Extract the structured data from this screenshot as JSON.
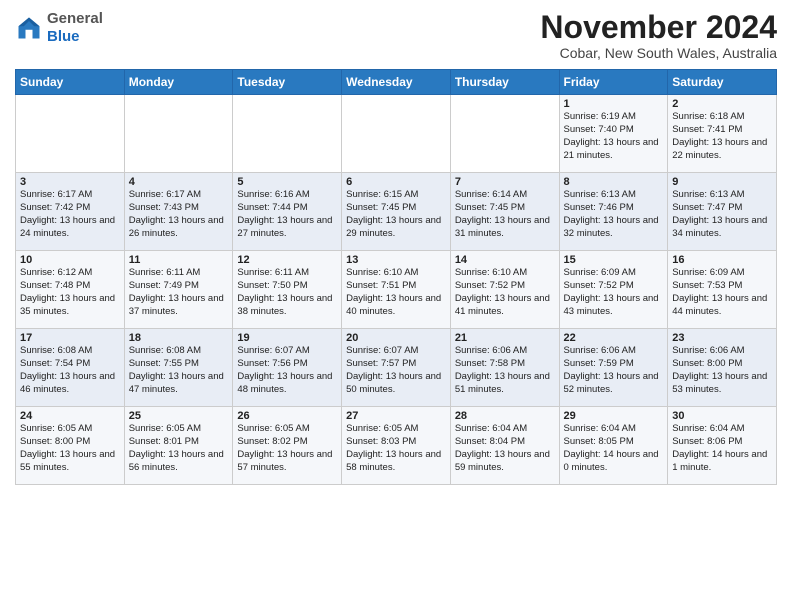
{
  "logo": {
    "general": "General",
    "blue": "Blue"
  },
  "header": {
    "month_title": "November 2024",
    "location": "Cobar, New South Wales, Australia"
  },
  "days_of_week": [
    "Sunday",
    "Monday",
    "Tuesday",
    "Wednesday",
    "Thursday",
    "Friday",
    "Saturday"
  ],
  "weeks": [
    [
      {
        "day": "",
        "info": ""
      },
      {
        "day": "",
        "info": ""
      },
      {
        "day": "",
        "info": ""
      },
      {
        "day": "",
        "info": ""
      },
      {
        "day": "",
        "info": ""
      },
      {
        "day": "1",
        "info": "Sunrise: 6:19 AM\nSunset: 7:40 PM\nDaylight: 13 hours and 21 minutes."
      },
      {
        "day": "2",
        "info": "Sunrise: 6:18 AM\nSunset: 7:41 PM\nDaylight: 13 hours and 22 minutes."
      }
    ],
    [
      {
        "day": "3",
        "info": "Sunrise: 6:17 AM\nSunset: 7:42 PM\nDaylight: 13 hours and 24 minutes."
      },
      {
        "day": "4",
        "info": "Sunrise: 6:17 AM\nSunset: 7:43 PM\nDaylight: 13 hours and 26 minutes."
      },
      {
        "day": "5",
        "info": "Sunrise: 6:16 AM\nSunset: 7:44 PM\nDaylight: 13 hours and 27 minutes."
      },
      {
        "day": "6",
        "info": "Sunrise: 6:15 AM\nSunset: 7:45 PM\nDaylight: 13 hours and 29 minutes."
      },
      {
        "day": "7",
        "info": "Sunrise: 6:14 AM\nSunset: 7:45 PM\nDaylight: 13 hours and 31 minutes."
      },
      {
        "day": "8",
        "info": "Sunrise: 6:13 AM\nSunset: 7:46 PM\nDaylight: 13 hours and 32 minutes."
      },
      {
        "day": "9",
        "info": "Sunrise: 6:13 AM\nSunset: 7:47 PM\nDaylight: 13 hours and 34 minutes."
      }
    ],
    [
      {
        "day": "10",
        "info": "Sunrise: 6:12 AM\nSunset: 7:48 PM\nDaylight: 13 hours and 35 minutes."
      },
      {
        "day": "11",
        "info": "Sunrise: 6:11 AM\nSunset: 7:49 PM\nDaylight: 13 hours and 37 minutes."
      },
      {
        "day": "12",
        "info": "Sunrise: 6:11 AM\nSunset: 7:50 PM\nDaylight: 13 hours and 38 minutes."
      },
      {
        "day": "13",
        "info": "Sunrise: 6:10 AM\nSunset: 7:51 PM\nDaylight: 13 hours and 40 minutes."
      },
      {
        "day": "14",
        "info": "Sunrise: 6:10 AM\nSunset: 7:52 PM\nDaylight: 13 hours and 41 minutes."
      },
      {
        "day": "15",
        "info": "Sunrise: 6:09 AM\nSunset: 7:52 PM\nDaylight: 13 hours and 43 minutes."
      },
      {
        "day": "16",
        "info": "Sunrise: 6:09 AM\nSunset: 7:53 PM\nDaylight: 13 hours and 44 minutes."
      }
    ],
    [
      {
        "day": "17",
        "info": "Sunrise: 6:08 AM\nSunset: 7:54 PM\nDaylight: 13 hours and 46 minutes."
      },
      {
        "day": "18",
        "info": "Sunrise: 6:08 AM\nSunset: 7:55 PM\nDaylight: 13 hours and 47 minutes."
      },
      {
        "day": "19",
        "info": "Sunrise: 6:07 AM\nSunset: 7:56 PM\nDaylight: 13 hours and 48 minutes."
      },
      {
        "day": "20",
        "info": "Sunrise: 6:07 AM\nSunset: 7:57 PM\nDaylight: 13 hours and 50 minutes."
      },
      {
        "day": "21",
        "info": "Sunrise: 6:06 AM\nSunset: 7:58 PM\nDaylight: 13 hours and 51 minutes."
      },
      {
        "day": "22",
        "info": "Sunrise: 6:06 AM\nSunset: 7:59 PM\nDaylight: 13 hours and 52 minutes."
      },
      {
        "day": "23",
        "info": "Sunrise: 6:06 AM\nSunset: 8:00 PM\nDaylight: 13 hours and 53 minutes."
      }
    ],
    [
      {
        "day": "24",
        "info": "Sunrise: 6:05 AM\nSunset: 8:00 PM\nDaylight: 13 hours and 55 minutes."
      },
      {
        "day": "25",
        "info": "Sunrise: 6:05 AM\nSunset: 8:01 PM\nDaylight: 13 hours and 56 minutes."
      },
      {
        "day": "26",
        "info": "Sunrise: 6:05 AM\nSunset: 8:02 PM\nDaylight: 13 hours and 57 minutes."
      },
      {
        "day": "27",
        "info": "Sunrise: 6:05 AM\nSunset: 8:03 PM\nDaylight: 13 hours and 58 minutes."
      },
      {
        "day": "28",
        "info": "Sunrise: 6:04 AM\nSunset: 8:04 PM\nDaylight: 13 hours and 59 minutes."
      },
      {
        "day": "29",
        "info": "Sunrise: 6:04 AM\nSunset: 8:05 PM\nDaylight: 14 hours and 0 minutes."
      },
      {
        "day": "30",
        "info": "Sunrise: 6:04 AM\nSunset: 8:06 PM\nDaylight: 14 hours and 1 minute."
      }
    ]
  ]
}
